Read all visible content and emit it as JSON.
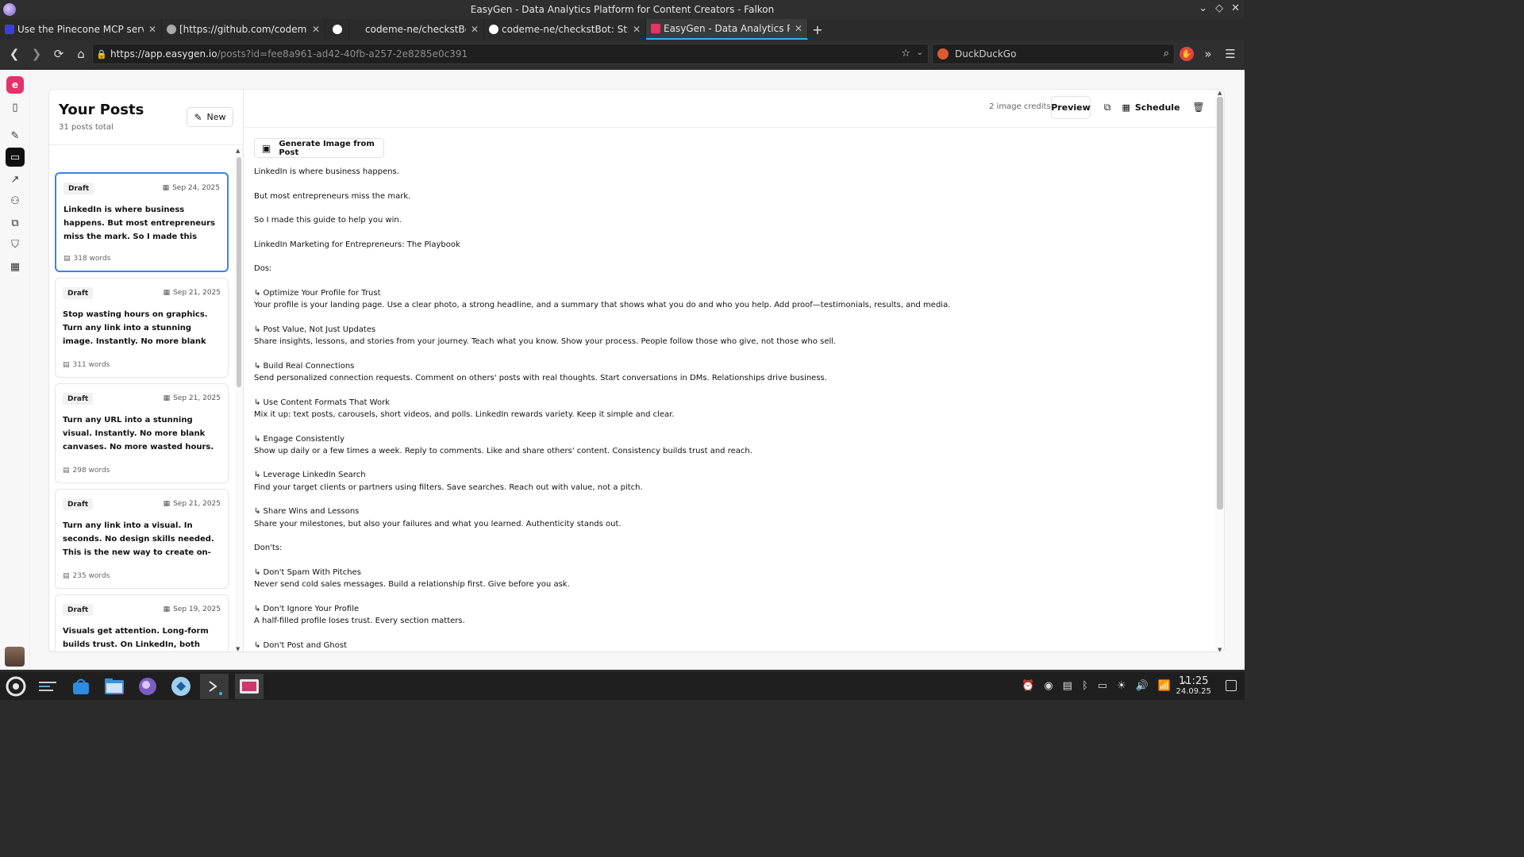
{
  "window": {
    "title": "EasyGen - Data Analytics Platform for Content Creators - Falkon"
  },
  "tabs": [
    {
      "title": "Use the Pinecone MCP server -...",
      "favicon_color": "#3b40d9"
    },
    {
      "title": "[https://github.com/codeme-n...",
      "favicon_color": "#aaaaaa"
    },
    {
      "title": "",
      "favicon_color": "#ffffff"
    },
    {
      "title": "codeme-ne/checkstBot",
      "favicon_color": "#2b2b2b"
    },
    {
      "title": "codeme-ne/checkstBot: Study ...",
      "favicon_color": "#ffffff"
    },
    {
      "title": "EasyGen - Data Analytics Platf...",
      "favicon_color": "#e8306b"
    }
  ],
  "address": {
    "host": "https://app.easygen.io",
    "path": "/posts?id=fee8a961-ad42-40fb-a257-2e8285e0c391"
  },
  "search": {
    "engine": "DuckDuckGo"
  },
  "app": {
    "logo_letter": "e",
    "accent_color": "#e8306b",
    "selected_color": "#3b82f6",
    "posts": {
      "title": "Your Posts",
      "count": "31 posts total",
      "new_label": "New",
      "items": [
        {
          "status": "Draft",
          "date": "Sep 24, 2025",
          "excerpt": "LinkedIn is where business happens. But most entrepreneurs miss the mark. So I made this guide to help you win. Linked...",
          "words": "318 words",
          "selected": true
        },
        {
          "status": "Draft",
          "date": "Sep 21, 2025",
          "excerpt": "Stop wasting hours on graphics. Turn any link into a stunning image. Instantly. No more blank screens or endless design...",
          "words": "311 words",
          "selected": false
        },
        {
          "status": "Draft",
          "date": "Sep 21, 2025",
          "excerpt": "Turn any URL into a stunning visual. Instantly. No more blank canvases. No more wasted hours. Here's how to creat...",
          "words": "298 words",
          "selected": false
        },
        {
          "status": "Draft",
          "date": "Sep 21, 2025",
          "excerpt": "Turn any link into a visual. In seconds. No design skills needed. This is the new way to create on-brand content. You can now...",
          "words": "235 words",
          "selected": false
        },
        {
          "status": "Draft",
          "date": "Sep 19, 2025",
          "excerpt": "Visuals get attention. Long-form builds trust. On LinkedIn, both matter. Here's how to use each one for real results:...",
          "words": "",
          "selected": false
        }
      ]
    },
    "editor": {
      "credits": "2 image credits",
      "preview_label": "Preview",
      "schedule_label": "Schedule",
      "generate_label": "Generate Image from Post",
      "lines": [
        "LinkedIn is where business happens.",
        "",
        "But most entrepreneurs miss the mark.",
        "",
        "So I made this guide to help you win.",
        "",
        "LinkedIn Marketing for Entrepreneurs: The Playbook",
        "",
        "Dos:",
        "",
        "↳ Optimize Your Profile for Trust",
        "Your profile is your landing page. Use a clear photo, a strong headline, and a summary that shows what you do and who you help. Add proof—testimonials, results, and media.",
        "",
        "↳ Post Value, Not Just Updates",
        "Share insights, lessons, and stories from your journey. Teach what you know. Show your process. People follow those who give, not those who sell.",
        "",
        "↳ Build Real Connections",
        "Send personalized connection requests. Comment on others' posts with real thoughts. Start conversations in DMs. Relationships drive business.",
        "",
        "↳ Use Content Formats That Work",
        "Mix it up: text posts, carousels, short videos, and polls. LinkedIn rewards variety. Keep it simple and clear.",
        "",
        "↳ Engage Consistently",
        "Show up daily or a few times a week. Reply to comments. Like and share others' content. Consistency builds trust and reach.",
        "",
        "↳ Leverage LinkedIn Search",
        "Find your target clients or partners using filters. Save searches. Reach out with value, not a pitch.",
        "",
        "↳ Share Wins and Lessons",
        "Share your milestones, but also your failures and what you learned. Authenticity stands out.",
        "",
        "Don'ts:",
        "",
        "↳ Don't Spam With Pitches",
        "Never send cold sales messages. Build a relationship first. Give before you ask.",
        "",
        "↳ Don't Ignore Your Profile",
        "A half-filled profile loses trust. Every section matters.",
        "",
        "↳ Don't Post and Ghost"
      ]
    }
  },
  "taskbar": {
    "time": "11:25",
    "date": "24.09.25"
  }
}
